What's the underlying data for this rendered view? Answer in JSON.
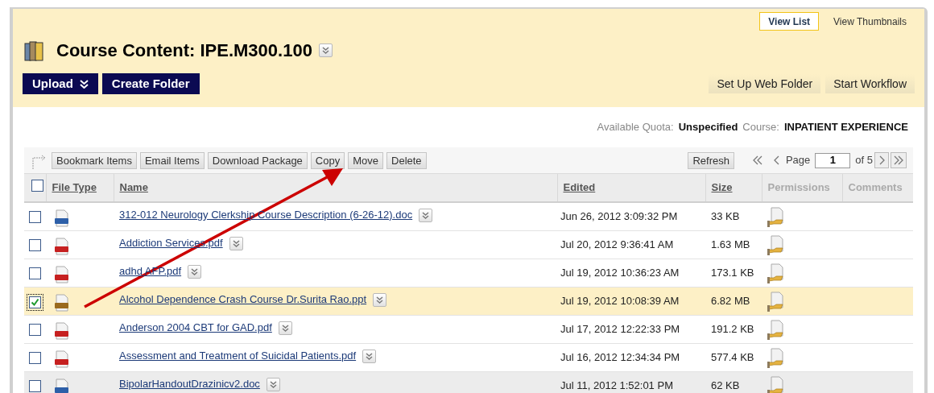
{
  "view_toggle": [
    {
      "label": "View List",
      "selected": true
    },
    {
      "label": "View Thumbnails",
      "selected": false
    }
  ],
  "title": "Course Content: IPE.M300.100",
  "header_buttons": [
    {
      "label": "Upload",
      "menu": true
    },
    {
      "label": "Create Folder",
      "menu": false
    }
  ],
  "header_actions": [
    "Set Up Web Folder",
    "Start Workflow"
  ],
  "quota": {
    "label": "Available Quota:",
    "value": "Unspecified",
    "course_label": "Course:",
    "course_value": "INPATIENT EXPERIENCE"
  },
  "toolbar": {
    "actions": [
      "Bookmark Items",
      "Email Items",
      "Download Package",
      "Copy",
      "Move",
      "Delete"
    ],
    "refresh": "Refresh",
    "page_label": "Page",
    "page": "1",
    "page_total": "of 5"
  },
  "table": {
    "all_checked": false,
    "columns": [
      {
        "label": "File Type",
        "sortable": true
      },
      {
        "label": "Name",
        "sortable": true
      },
      {
        "label": "Edited",
        "sortable": true
      },
      {
        "label": "Size",
        "sortable": true
      },
      {
        "label": "Permissions",
        "sortable": false
      },
      {
        "label": "Comments",
        "sortable": false
      }
    ],
    "rows": [
      {
        "kind": "doc",
        "name": "312-012 Neurology Clerkship Course Description (6-26-12).doc",
        "edited": "Jun 26, 2012 3:09:32 PM",
        "size": "33 KB",
        "selected": false,
        "hovered": false
      },
      {
        "kind": "pdf",
        "name": "Addiction Services.pdf",
        "edited": "Jul 20, 2012 9:36:41 AM",
        "size": "1.63 MB",
        "selected": false,
        "hovered": false
      },
      {
        "kind": "pdf",
        "name": "adhd AFP.pdf",
        "edited": "Jul 19, 2012 10:36:23 AM",
        "size": "173.1 KB",
        "selected": false,
        "hovered": false
      },
      {
        "kind": "ppt",
        "name": "Alcohol Dependence Crash Course Dr.Surita Rao.ppt",
        "edited": "Jul 19, 2012 10:08:39 AM",
        "size": "6.82 MB",
        "selected": true,
        "hovered": false
      },
      {
        "kind": "pdf",
        "name": "Anderson 2004 CBT for GAD.pdf",
        "edited": "Jul 17, 2012 12:22:33 PM",
        "size": "191.2 KB",
        "selected": false,
        "hovered": false
      },
      {
        "kind": "pdf",
        "name": "Assessment and Treatment of Suicidal Patients.pdf",
        "edited": "Jul 16, 2012 12:34:34 PM",
        "size": "577.4 KB",
        "selected": false,
        "hovered": false
      },
      {
        "kind": "doc",
        "name": "BipolarHandoutDrazinicv2.doc",
        "edited": "Jul 11, 2012 1:52:01 PM",
        "size": "62 KB",
        "selected": false,
        "hovered": true
      }
    ]
  }
}
